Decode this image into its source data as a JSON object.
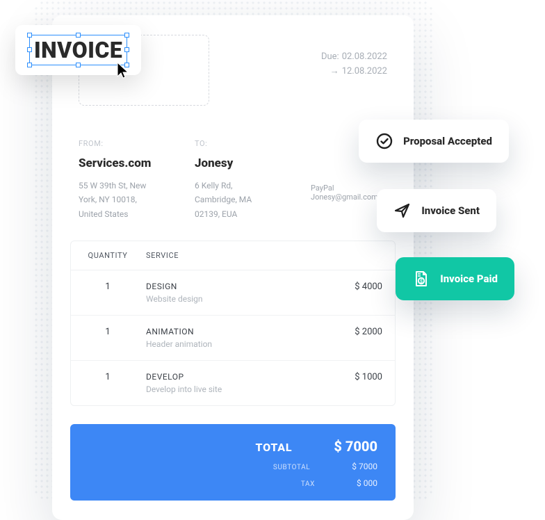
{
  "title": "INVOICE",
  "dates": {
    "due_label": "Due:",
    "due_date": "02.08.2022",
    "arrow": "→",
    "paid_date": "12.08.2022"
  },
  "from": {
    "label": "FROM:",
    "name": "Services.com",
    "address_line1": "55 W 39th St, New",
    "address_line2": "York, NY 10018,",
    "address_line3": "United States"
  },
  "to": {
    "label": "TO:",
    "name": "Jonesy",
    "address_line1": "6 Kelly Rd,",
    "address_line2": "Cambridge, MA",
    "address_line3": "02139, EUA"
  },
  "payment": {
    "method": "PayPal",
    "email": "Jonesy@gmail.com"
  },
  "table": {
    "headers": {
      "quantity": "QUANTITY",
      "service": "SERVICE"
    },
    "rows": [
      {
        "qty": "1",
        "service": "DESIGN",
        "desc": "Website design",
        "price": "$ 4000"
      },
      {
        "qty": "1",
        "service": "ANIMATION",
        "desc": "Header animation",
        "price": "$ 2000"
      },
      {
        "qty": "1",
        "service": "DEVELOP",
        "desc": "Develop into live site",
        "price": "$ 1000"
      }
    ]
  },
  "totals": {
    "total_label": "TOTAL",
    "total_value": "$ 7000",
    "subtotal_label": "SUBTOTAL",
    "subtotal_value": "$ 7000",
    "tax_label": "TAX",
    "tax_value": "$ 000"
  },
  "chips": {
    "proposal": "Proposal Accepted",
    "sent": "Invoice Sent",
    "paid": "Invoice Paid"
  }
}
